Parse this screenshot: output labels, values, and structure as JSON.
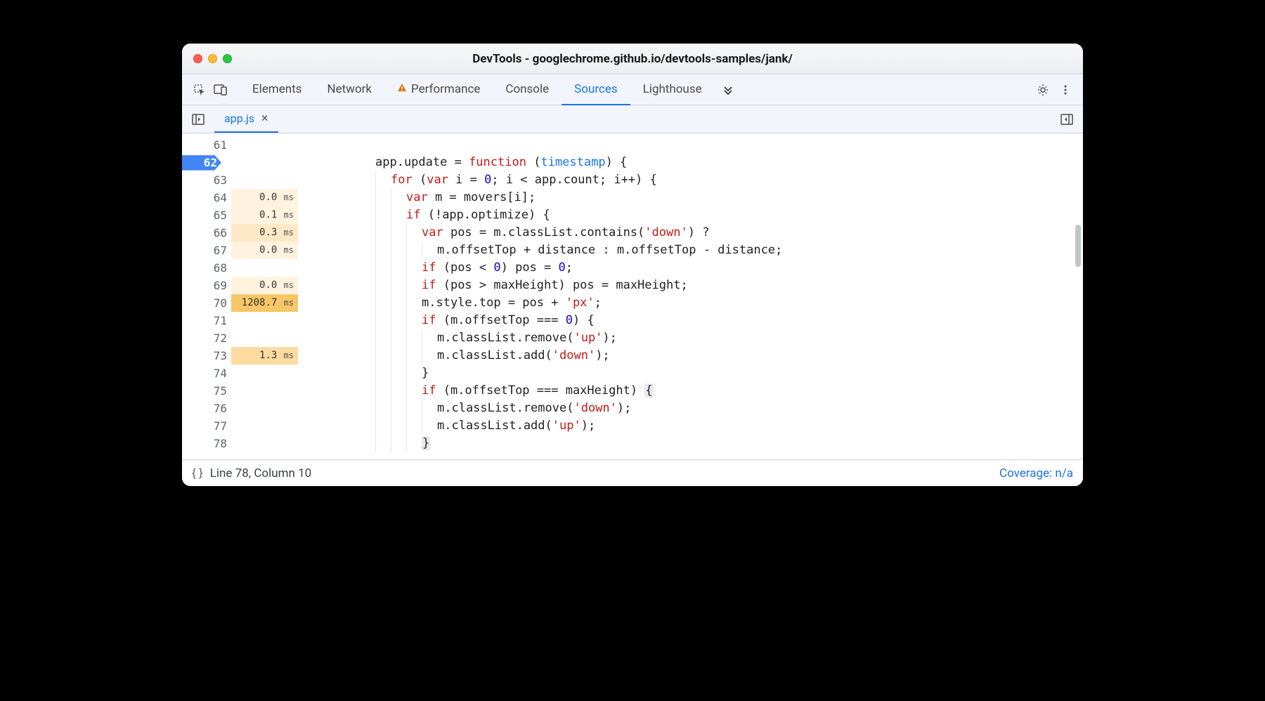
{
  "window_title": "DevTools - googlechrome.github.io/devtools-samples/jank/",
  "main_tabs": [
    "Elements",
    "Network",
    "Performance",
    "Console",
    "Sources",
    "Lighthouse"
  ],
  "main_tab_active": "Sources",
  "main_tab_warning": "Performance",
  "file_tab": "app.js",
  "status_line": "Line 78, Column 10",
  "coverage": "Coverage: n/a",
  "code_lines": [
    {
      "num": 61,
      "breakpoint": false,
      "timing": null,
      "tokens": []
    },
    {
      "num": 62,
      "breakpoint": true,
      "timing": null,
      "tokens": [
        {
          "t": "app.update = "
        },
        {
          "t": "function",
          "c": "kw"
        },
        {
          "t": " ("
        },
        {
          "t": "timestamp",
          "c": "fn"
        },
        {
          "t": ") {"
        }
      ]
    },
    {
      "num": 63,
      "breakpoint": false,
      "timing": null,
      "indent": 1,
      "tokens": [
        {
          "t": "for",
          "c": "kw"
        },
        {
          "t": " ("
        },
        {
          "t": "var",
          "c": "kw"
        },
        {
          "t": " i = "
        },
        {
          "t": "0",
          "c": "num"
        },
        {
          "t": "; i < app.count; i++) {"
        }
      ]
    },
    {
      "num": 64,
      "breakpoint": false,
      "timing": "0.0",
      "tc": "t0",
      "indent": 2,
      "tokens": [
        {
          "t": "var",
          "c": "kw"
        },
        {
          "t": " m = movers[i];"
        }
      ]
    },
    {
      "num": 65,
      "breakpoint": false,
      "timing": "0.1",
      "tc": "t0",
      "indent": 2,
      "tokens": [
        {
          "t": "if",
          "c": "kw"
        },
        {
          "t": " (!app.optimize) {"
        }
      ]
    },
    {
      "num": 66,
      "breakpoint": false,
      "timing": "0.3",
      "tc": "t1",
      "indent": 3,
      "tokens": [
        {
          "t": "var",
          "c": "kw"
        },
        {
          "t": " pos = m.classList.contains("
        },
        {
          "t": "'down'",
          "c": "str"
        },
        {
          "t": ") ?"
        }
      ]
    },
    {
      "num": 67,
      "breakpoint": false,
      "timing": "0.0",
      "tc": "t0",
      "indent": 4,
      "tokens": [
        {
          "t": "m.offsetTop + distance : m.offsetTop - distance;"
        }
      ]
    },
    {
      "num": 68,
      "breakpoint": false,
      "timing": null,
      "indent": 3,
      "tokens": [
        {
          "t": "if",
          "c": "kw"
        },
        {
          "t": " (pos < "
        },
        {
          "t": "0",
          "c": "num"
        },
        {
          "t": ") pos = "
        },
        {
          "t": "0",
          "c": "num"
        },
        {
          "t": ";"
        }
      ]
    },
    {
      "num": 69,
      "breakpoint": false,
      "timing": "0.0",
      "tc": "t0",
      "indent": 3,
      "tokens": [
        {
          "t": "if",
          "c": "kw"
        },
        {
          "t": " (pos > maxHeight) pos = maxHeight;"
        }
      ]
    },
    {
      "num": 70,
      "breakpoint": false,
      "timing": "1208.7",
      "tc": "hot",
      "indent": 3,
      "tokens": [
        {
          "t": "m.style.top = pos + "
        },
        {
          "t": "'px'",
          "c": "str"
        },
        {
          "t": ";"
        }
      ]
    },
    {
      "num": 71,
      "breakpoint": false,
      "timing": null,
      "indent": 3,
      "tokens": [
        {
          "t": "if",
          "c": "kw"
        },
        {
          "t": " (m.offsetTop === "
        },
        {
          "t": "0",
          "c": "num"
        },
        {
          "t": ") {"
        }
      ]
    },
    {
      "num": 72,
      "breakpoint": false,
      "timing": null,
      "indent": 4,
      "tokens": [
        {
          "t": "m.classList.remove("
        },
        {
          "t": "'up'",
          "c": "str"
        },
        {
          "t": ");"
        }
      ]
    },
    {
      "num": 73,
      "breakpoint": false,
      "timing": "1.3",
      "tc": "t2",
      "indent": 4,
      "tokens": [
        {
          "t": "m.classList.add("
        },
        {
          "t": "'down'",
          "c": "str"
        },
        {
          "t": ");"
        }
      ]
    },
    {
      "num": 74,
      "breakpoint": false,
      "timing": null,
      "indent": 3,
      "tokens": [
        {
          "t": "}"
        }
      ]
    },
    {
      "num": 75,
      "breakpoint": false,
      "timing": null,
      "indent": 3,
      "tokens": [
        {
          "t": "if",
          "c": "kw"
        },
        {
          "t": " (m.offsetTop === maxHeight) "
        },
        {
          "t": "{",
          "c": "paren-hl"
        }
      ]
    },
    {
      "num": 76,
      "breakpoint": false,
      "timing": null,
      "indent": 4,
      "tokens": [
        {
          "t": "m.classList.remove("
        },
        {
          "t": "'down'",
          "c": "str"
        },
        {
          "t": ");"
        }
      ]
    },
    {
      "num": 77,
      "breakpoint": false,
      "timing": null,
      "indent": 4,
      "tokens": [
        {
          "t": "m.classList.add("
        },
        {
          "t": "'up'",
          "c": "str"
        },
        {
          "t": ");"
        }
      ]
    },
    {
      "num": 78,
      "breakpoint": false,
      "timing": null,
      "indent": 3,
      "tokens": [
        {
          "t": "}",
          "c": "paren-hl"
        }
      ]
    }
  ]
}
